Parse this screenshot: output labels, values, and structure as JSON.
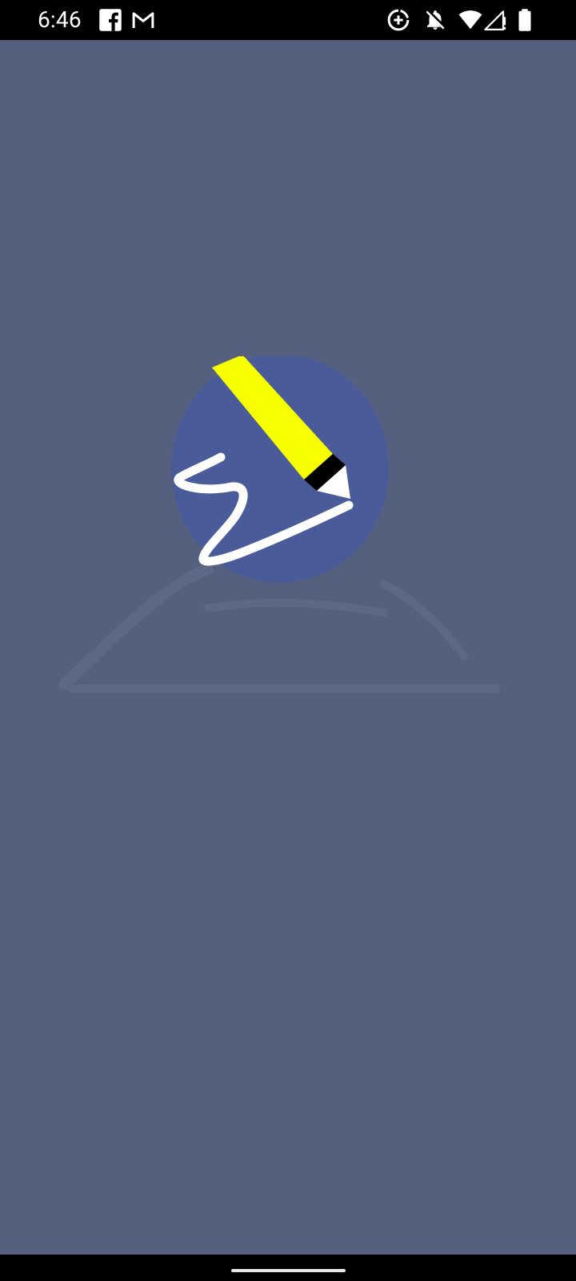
{
  "status_bar": {
    "time": "6:46",
    "left_icons": [
      "facebook-icon",
      "gmail-icon"
    ],
    "right_icons": [
      "data-saver-icon",
      "notifications-off-icon",
      "wifi-icon",
      "cell-signal-icon",
      "battery-icon"
    ]
  },
  "splash": {
    "logo_icon": "pen-scribble-logo-icon"
  },
  "colors": {
    "background": "#55607f",
    "logo_circle": "#4a5b9a",
    "pen_body": "#f7ff00",
    "pen_tip": "#ffffff",
    "scribble": "#ffffff"
  }
}
